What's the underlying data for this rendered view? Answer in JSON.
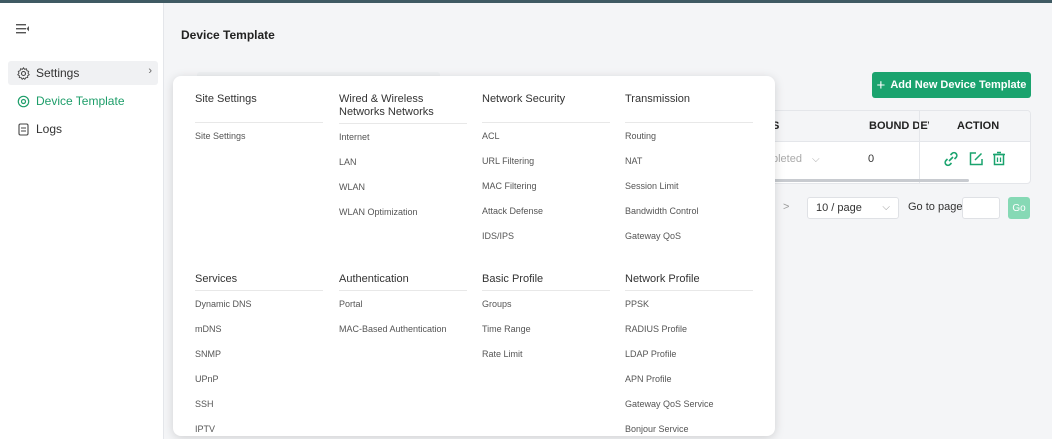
{
  "sidebar": {
    "items": [
      {
        "label": "Settings"
      },
      {
        "label": "Device Template"
      },
      {
        "label": "Logs"
      }
    ]
  },
  "page": {
    "title": "Device Template",
    "add_button": "Add New Device Template"
  },
  "table": {
    "headers": [
      "S",
      "BOUND DEV",
      "ACTION"
    ],
    "row": {
      "status": "pleted",
      "bound": "0"
    }
  },
  "pagination": {
    "next": ">",
    "page_size": "10 / page",
    "goto_label": "Go to page",
    "go": "Go"
  },
  "menu": {
    "sections": [
      {
        "title": "Site Settings",
        "items": [
          "Site Settings"
        ]
      },
      {
        "title": "Wired & Wireless Networks Networks",
        "items": [
          "Internet",
          "LAN",
          "WLAN",
          "WLAN Optimization"
        ]
      },
      {
        "title": "Network Security",
        "items": [
          "ACL",
          "URL Filtering",
          "MAC Filtering",
          "Attack Defense",
          "IDS/IPS"
        ]
      },
      {
        "title": "Transmission",
        "items": [
          "Routing",
          "NAT",
          "Session Limit",
          "Bandwidth Control",
          "Gateway QoS"
        ]
      },
      {
        "title": "Services",
        "items": [
          "Dynamic DNS",
          "mDNS",
          "SNMP",
          "UPnP",
          "SSH",
          "IPTV"
        ]
      },
      {
        "title": "Authentication",
        "items": [
          "Portal",
          "MAC-Based Authentication"
        ]
      },
      {
        "title": "Basic Profile",
        "items": [
          "Groups",
          "Time Range",
          "Rate Limit"
        ]
      },
      {
        "title": "Network Profile",
        "items": [
          "PPSK",
          "RADIUS Profile",
          "LDAP Profile",
          "APN Profile",
          "Gateway QoS Service",
          "Bonjour Service"
        ]
      }
    ]
  },
  "colors": {
    "accent": "#1aa36e",
    "go_disabled": "#86d9b5"
  }
}
